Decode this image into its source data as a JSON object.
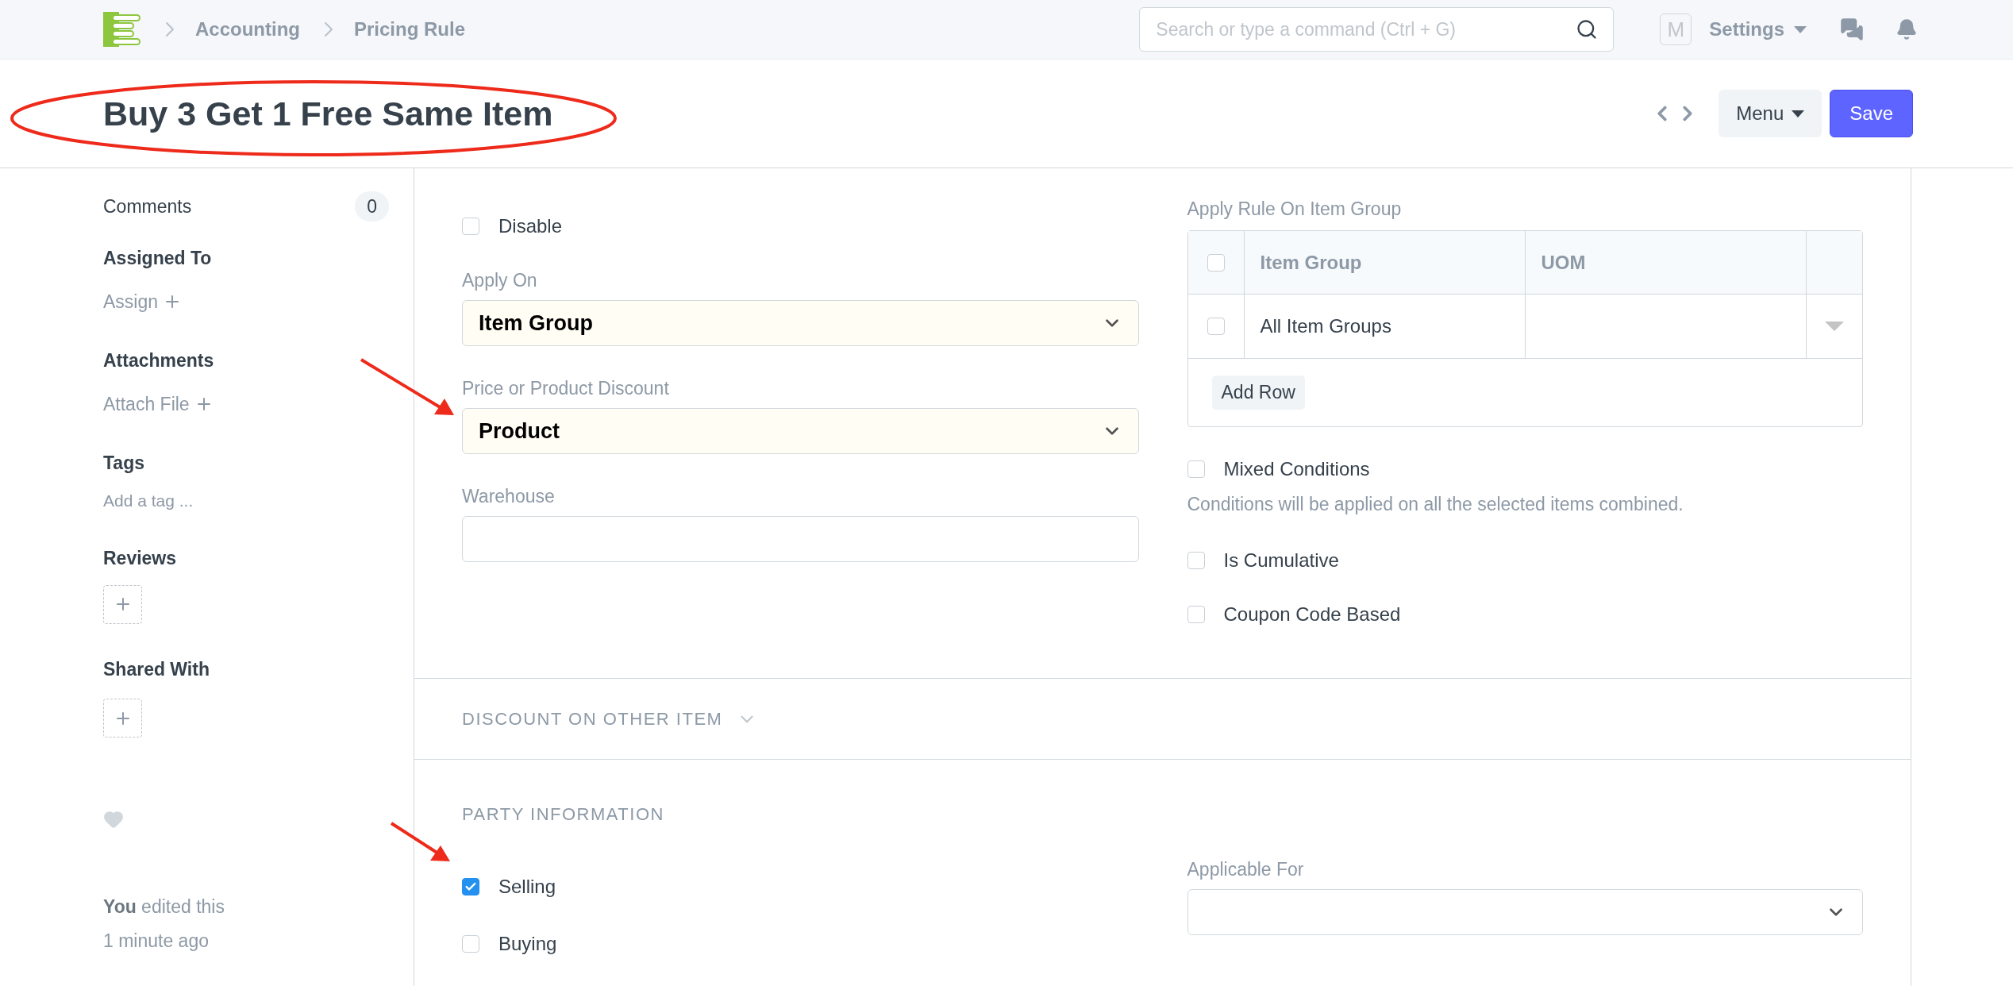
{
  "navbar": {
    "breadcrumbs": [
      "Accounting",
      "Pricing Rule"
    ],
    "search": {
      "placeholder": "Search or type a command (Ctrl + G)"
    },
    "avatar": "M",
    "settings": "Settings"
  },
  "header": {
    "title": "Buy 3 Get 1 Free Same Item",
    "menu": "Menu",
    "save": "Save"
  },
  "sidebar": {
    "comments": {
      "label": "Comments",
      "count": "0"
    },
    "assigned_to": {
      "title": "Assigned To",
      "action": "Assign"
    },
    "attachments": {
      "title": "Attachments",
      "action": "Attach File"
    },
    "tags": {
      "title": "Tags",
      "placeholder": "Add a tag ..."
    },
    "reviews": {
      "title": "Reviews"
    },
    "shared_with": {
      "title": "Shared With"
    },
    "edited": "**You** edited this",
    "edited_time": "1 minute ago"
  },
  "main": {
    "left_fields": [
      {
        "kind": "checkbox",
        "label": "Disable",
        "checked": false
      },
      {
        "kind": "select",
        "label": "Apply On",
        "value": "Item Group"
      },
      {
        "kind": "select",
        "label": "Price or Product Discount",
        "value": "Product"
      },
      {
        "kind": "input",
        "label": "Warehouse"
      }
    ],
    "right_fields": [
      {
        "kind": "table",
        "label": "Apply Rule On Item Group",
        "columns": [
          "Item Group",
          "UOM"
        ],
        "header_checked": false,
        "rows": [
          {
            "item_group": "All Item Groups",
            "checked": false
          }
        ],
        "add_row": "Add Row"
      },
      {
        "kind": "checkbox",
        "label": "Mixed Conditions",
        "checked": false,
        "description": "Conditions will be applied on all the selected items combined."
      },
      {
        "kind": "checkbox",
        "label": "Is Cumulative",
        "checked": false
      },
      {
        "kind": "checkbox",
        "label": "Coupon Code Based",
        "checked": false
      }
    ]
  },
  "discount_section": {
    "title": "DISCOUNT ON OTHER ITEM",
    "expanded": false
  },
  "party_section": {
    "title": "PARTY INFORMATION",
    "left_fields": [
      {
        "kind": "checkbox",
        "label": "Selling",
        "checked": true
      },
      {
        "kind": "checkbox",
        "label": "Buying",
        "checked": false
      }
    ],
    "right_fields": [
      {
        "kind": "select",
        "label": "Applicable For"
      }
    ]
  }
}
